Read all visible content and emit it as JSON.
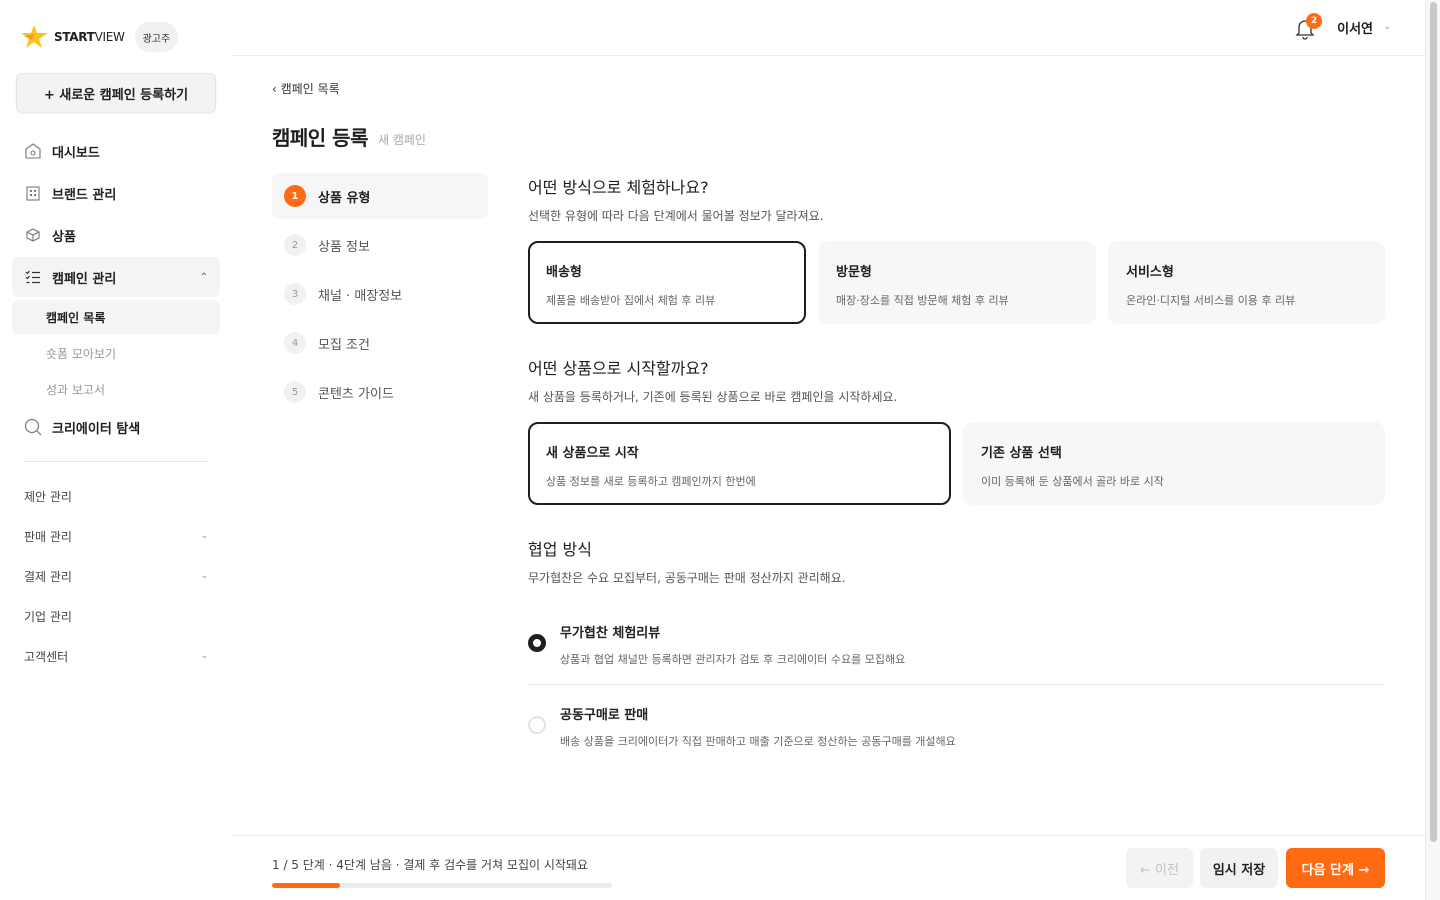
{
  "brand": {
    "logo_text_a": "START",
    "logo_text_b": "VIEW",
    "role_badge": "광고주",
    "accent_color": "#ff6a13"
  },
  "sidebar": {
    "new_campaign": "+ 새로운 캠페인 등록하기",
    "items": [
      {
        "label": "대시보드",
        "icon": "dashboard-icon"
      },
      {
        "label": "브랜드 관리",
        "icon": "building-icon"
      },
      {
        "label": "상품",
        "icon": "box-icon"
      },
      {
        "label": "캠페인 관리",
        "icon": "checklist-icon"
      },
      {
        "label": "크리에이터 탐색",
        "icon": "search-icon"
      }
    ],
    "campaign_sub": [
      "캠페인 목록",
      "숏폼 모아보기",
      "성과 보고서"
    ],
    "secondary": [
      "제안 관리",
      "판매 관리",
      "결제 관리",
      "기업 관리",
      "고객센터"
    ]
  },
  "topbar": {
    "notification_count": "2",
    "user_name": "이서연"
  },
  "main": {
    "back_link": "‹ 캠페인 목록",
    "title": "캠페인 등록",
    "subtitle": "새 캠페인",
    "steps": [
      {
        "num": "1",
        "label": "상품 유형"
      },
      {
        "num": "2",
        "label": "상품 정보"
      },
      {
        "num": "3",
        "label": "채널 · 매장정보"
      },
      {
        "num": "4",
        "label": "모집 조건"
      },
      {
        "num": "5",
        "label": "콘텐츠 가이드"
      }
    ],
    "q1": {
      "title": "어떤 방식으로 체험하나요?",
      "desc": "선택한 유형에 따라 다음 단계에서 물어볼 정보가 달라져요.",
      "options": [
        {
          "title": "배송형",
          "desc": "제품을 배송받아 집에서 체험 후 리뷰"
        },
        {
          "title": "방문형",
          "desc": "매장·장소를 직접 방문해 체험 후 리뷰"
        },
        {
          "title": "서비스형",
          "desc": "온라인·디지털 서비스를 이용 후 리뷰"
        }
      ]
    },
    "q2": {
      "title": "어떤 상품으로 시작할까요?",
      "desc": "새 상품을 등록하거나, 기존에 등록된 상품으로 바로 캠페인을 시작하세요.",
      "options": [
        {
          "title": "새 상품으로 시작",
          "desc": "상품 정보를 새로 등록하고 캠페인까지 한번에"
        },
        {
          "title": "기존 상품 선택",
          "desc": "이미 등록해 둔 상품에서 골라 바로 시작"
        }
      ]
    },
    "q3": {
      "title": "협업 방식",
      "desc": "무가협찬은 수요 모집부터, 공동구매는 판매 정산까지 관리해요.",
      "options": [
        {
          "title": "무가협찬 체험리뷰",
          "desc": "상품과 협업 채널만 등록하면 관리자가 검토 후 크리에이터 수요를 모집해요"
        },
        {
          "title": "공동구매로 판매",
          "desc": "배송 상품을 크리에이터가 직접 판매하고 매출 기준으로 정산하는 공동구매를 개설해요"
        }
      ]
    }
  },
  "footer": {
    "progress_text": "1 / 5 단계 · 4단계 남음 · 결제 후 검수를 거쳐 모집이 시작돼요",
    "progress_fraction": 0.2,
    "prev": "← 이전",
    "save": "임시 저장",
    "next": "다음 단계 →"
  }
}
